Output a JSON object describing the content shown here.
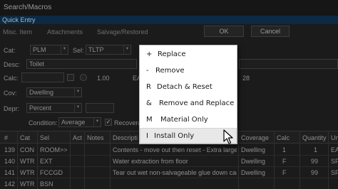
{
  "window": {
    "title": "Search/Macros",
    "section": "Quick Entry"
  },
  "tabs": [
    "Misc. Item",
    "Attachments",
    "Salvage/Restored"
  ],
  "buttons": {
    "ok": "OK",
    "cancel": "Cancel"
  },
  "form": {
    "cat_label": "Cat:",
    "cat_value": "PLM",
    "sel_label": "Sel:",
    "sel_value": "TLTP",
    "desc_label": "Desc:",
    "desc_value": "Toilet",
    "calc_label": "Calc:",
    "calc_value": "1.00",
    "unit_fragment": "EA",
    "right_fragment": "28",
    "cov_label": "Cov:",
    "cov_value": "Dwelling",
    "depr_label": "Depr:",
    "depr_value": "Percent",
    "condition_label": "Condition:",
    "condition_value": "Average",
    "recoverable_label": "Recovera"
  },
  "grid": {
    "headers": [
      "#",
      "Cat",
      "Sel",
      "Act",
      "Notes",
      "Descripti",
      "Coverage",
      "Calc",
      "Quantity",
      "Un"
    ],
    "rows": [
      {
        "num": "139",
        "cat": "CON",
        "sel": "ROOM>>",
        "act": "",
        "desc": "Contents - move out then reset - Extra large ro",
        "coverage": "Dwelling",
        "calc": "1",
        "quantity": "1",
        "unit": "EA"
      },
      {
        "num": "140",
        "cat": "WTR",
        "sel": "EXT",
        "act": "",
        "desc": "Water extraction from floor",
        "coverage": "Dwelling",
        "calc": "F",
        "quantity": "99",
        "unit": "SF"
      },
      {
        "num": "141",
        "cat": "WTR",
        "sel": "FCCGD",
        "act": "",
        "desc": "Tear out wet non-salvageable glue down carp",
        "coverage": "Dwelling",
        "calc": "F",
        "quantity": "99",
        "unit": "SF"
      },
      {
        "num": "142",
        "cat": "WTR",
        "sel": "BSN",
        "act": "",
        "desc": "",
        "coverage": "",
        "calc": "",
        "quantity": "",
        "unit": ""
      }
    ]
  },
  "menu": {
    "items": [
      {
        "key": "+",
        "label": "Replace"
      },
      {
        "key": "-",
        "label": "Remove"
      },
      {
        "key": "R",
        "label": "Detach & Reset"
      },
      {
        "key": "&",
        "label": "Remove and Replace"
      },
      {
        "key": "M",
        "label": "Material Only"
      },
      {
        "key": "I",
        "label": "Install Only"
      }
    ],
    "highlighted_index": 5
  }
}
